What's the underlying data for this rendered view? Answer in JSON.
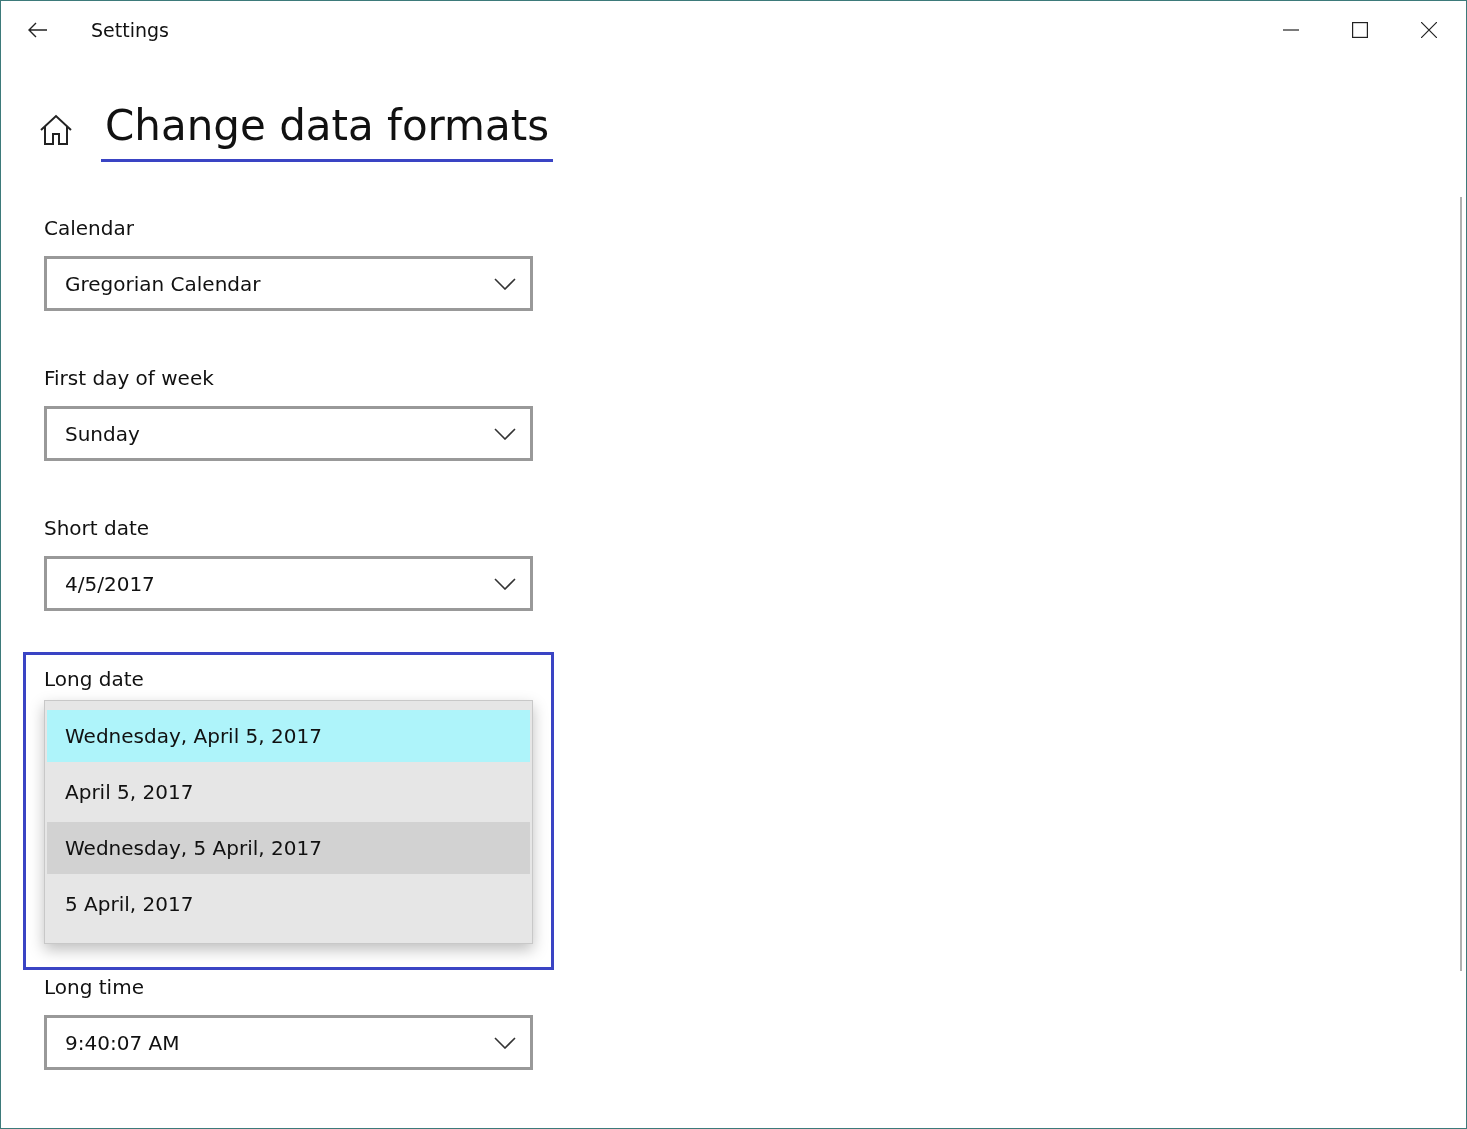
{
  "window": {
    "title": "Settings"
  },
  "page": {
    "title": "Change data formats",
    "underlined": true
  },
  "fields": [
    {
      "label": "Calendar",
      "kind": "dropdown",
      "value": "Gregorian Calendar",
      "highlighted": false
    },
    {
      "label": "First day of week",
      "kind": "dropdown",
      "value": "Sunday",
      "highlighted": false
    },
    {
      "label": "Short date",
      "kind": "dropdown",
      "value": "4/5/2017",
      "highlighted": false
    },
    {
      "label": "Long date",
      "kind": "open-list",
      "highlighted": true,
      "options": [
        {
          "text": "Wednesday, April 5, 2017",
          "selected": true,
          "hovered": false
        },
        {
          "text": "April 5, 2017",
          "selected": false,
          "hovered": false
        },
        {
          "text": "Wednesday, 5 April, 2017",
          "selected": false,
          "hovered": true
        },
        {
          "text": "5 April, 2017",
          "selected": false,
          "hovered": false
        }
      ]
    },
    {
      "label": "Long time",
      "kind": "dropdown",
      "value": "9:40:07 AM",
      "highlighted": false
    }
  ]
}
